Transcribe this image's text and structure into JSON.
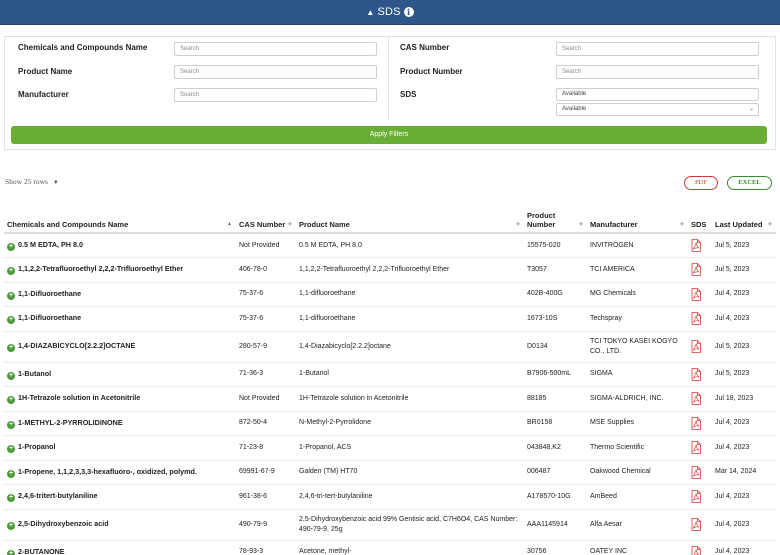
{
  "banner": {
    "title": "SDS"
  },
  "filters": {
    "chemicals_label": "Chemicals and Compounds Name",
    "chemicals_placeholder": "Search",
    "product_name_label": "Product Name",
    "product_name_placeholder": "Search",
    "manufacturer_label": "Manufacturer",
    "manufacturer_placeholder": "Search",
    "cas_label": "CAS Number",
    "cas_placeholder": "Search",
    "product_number_label": "Product Number",
    "product_number_placeholder": "Search",
    "sds_label": "SDS",
    "sds_value": "Available",
    "sds_select_value": "Available",
    "apply_label": "Apply Filters"
  },
  "toolbar": {
    "show_rows": "Show 25 rows",
    "pdf": "PDF",
    "excel": "EXCEL"
  },
  "table": {
    "headers": {
      "name": "Chemicals and Compounds Name",
      "cas": "CAS Number",
      "product_name": "Product Name",
      "product_number": "Product Number",
      "manufacturer": "Manufacturer",
      "sds": "SDS",
      "updated": "Last Updated"
    },
    "rows": [
      {
        "name": "0.5 M EDTA, PH 8.0",
        "cas": "Not Provided",
        "product_name": "0.5 M EDTA, PH 8.0",
        "product_number": "15575-020",
        "manufacturer": "INVITROGEN",
        "updated": "Jul 5, 2023"
      },
      {
        "name": "1,1,2,2-Tetrafluoroethyl 2,2,2-Trifluoroethyl Ether",
        "cas": "406-78-0",
        "product_name": "1,1,2,2-Tetrafluoroethyl 2,2,2-Trifluoroethyl Ether",
        "product_number": "T3057",
        "manufacturer": "TCI AMERICA",
        "updated": "Jul 5, 2023"
      },
      {
        "name": "1,1-Difluoroethane",
        "cas": "75-37-6",
        "product_name": "1,1-difluoroethane",
        "product_number": "402B-400G",
        "manufacturer": "MG Chemicals",
        "updated": "Jul 4, 2023"
      },
      {
        "name": "1,1-Difluoroethane",
        "cas": "75-37-6",
        "product_name": "1,1-difluoroethane",
        "product_number": "1673-10S",
        "manufacturer": "Techspray",
        "updated": "Jul 4, 2023"
      },
      {
        "name": "1,4-DIAZABICYCLO[2.2.2]OCTANE",
        "cas": "280-57-9",
        "product_name": "1,4-Diazabicyclo[2.2.2]octane",
        "product_number": "D0134",
        "manufacturer": "TCI TOKYO KASEI KOGYO CO., LTD.",
        "updated": "Jul 5, 2023"
      },
      {
        "name": "1-Butanol",
        "cas": "71-36-3",
        "product_name": "1-Butanol",
        "product_number": "B7906-500mL",
        "manufacturer": "SIGMA",
        "updated": "Jul 5, 2023"
      },
      {
        "name": "1H-Tetrazole solution in Acetonitrile",
        "cas": "Not Provided",
        "product_name": "1H-Tetrazole solution in Acetonitrile",
        "product_number": "88185",
        "manufacturer": "SIGMA-ALDRICH, INC.",
        "updated": "Jul 18, 2023"
      },
      {
        "name": "1-METHYL-2-PYRROLIDINONE",
        "cas": "872-50-4",
        "product_name": "N-Methyl-2-Pyrrolidone",
        "product_number": "BR0158",
        "manufacturer": "MSE Supplies",
        "updated": "Jul 4, 2023"
      },
      {
        "name": "1-Propanol",
        "cas": "71-23-8",
        "product_name": "1-Propanol, ACS",
        "product_number": "043848.K2",
        "manufacturer": "Thermo Scientific",
        "updated": "Jul 4, 2023"
      },
      {
        "name": "1-Propene, 1,1,2,3,3,3-hexafluoro-, oxidized, polymd.",
        "cas": "69991-67-9",
        "product_name": "Galden (TM) HT70",
        "product_number": "006487",
        "manufacturer": "Oakwood Chemical",
        "updated": "Mar 14, 2024"
      },
      {
        "name": "2,4,6-tritert-butylaniline",
        "cas": "961-38-6",
        "product_name": "2,4,6-tri-tert-butylaniline",
        "product_number": "A178570-10G",
        "manufacturer": "AmBeed",
        "updated": "Jul 4, 2023"
      },
      {
        "name": "2,5-Dihydroxybenzoic acid",
        "cas": "490-79-9",
        "product_name": "2,5-Dihydroxybenzoic acid 99% Gentisic acid, C7H6O4, CAS Number: 490-79-9, 25g",
        "product_number": "AAA1145914",
        "manufacturer": "Alfa Aesar",
        "updated": "Jul 4, 2023"
      },
      {
        "name": "2-BUTANONE",
        "cas": "78-93-3",
        "product_name": "Acetone, methyl-",
        "product_number": "30756",
        "manufacturer": "OATEY INC",
        "updated": "Jul 4, 2023"
      }
    ]
  },
  "colors": {
    "banner": "#2f5688",
    "apply": "#6aad34",
    "pdf": "#d23a3a",
    "excel": "#3a8a3a",
    "plus": "#4f9a3c"
  }
}
